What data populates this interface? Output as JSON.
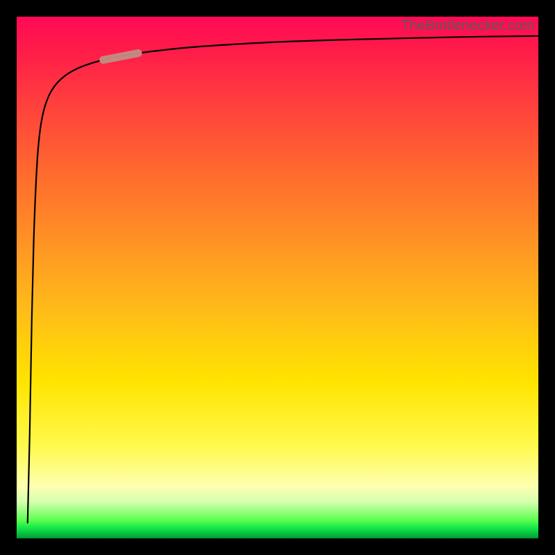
{
  "watermark": "TheBottlenecker.com",
  "colors": {
    "frame": "#000000",
    "curve": "#000000",
    "marker": "#c38d82",
    "gradient_stops": [
      "#ff0a56",
      "#ff3a3f",
      "#ff8f25",
      "#ffe400",
      "#feffb0",
      "#12e84a",
      "#009c35"
    ]
  },
  "chart_data": {
    "type": "line",
    "title": "",
    "xlabel": "",
    "ylabel": "",
    "xlim": [
      0,
      100
    ],
    "ylim": [
      0,
      100
    ],
    "note": "Axes carry no tick labels; values are read as percentages of the plot area. y is drawn inverted in pixel space (higher y value = nearer the top).",
    "series": [
      {
        "name": "bottleneck-curve",
        "x": [
          2.1,
          2.5,
          2.9,
          3.3,
          3.7,
          4.1,
          4.6,
          5.3,
          6.3,
          7.6,
          9.3,
          11.3,
          13.8,
          16.6,
          19.9,
          23.3,
          27.3,
          33.0,
          40.0,
          49.0,
          60.0,
          72.0,
          85.0,
          100.0
        ],
        "y": [
          3.0,
          20.0,
          42.0,
          58.0,
          68.0,
          74.5,
          79.0,
          82.4,
          85.1,
          87.1,
          88.7,
          89.9,
          90.9,
          91.7,
          92.4,
          93.0,
          93.5,
          94.1,
          94.6,
          95.1,
          95.5,
          95.8,
          96.1,
          96.3
        ]
      }
    ],
    "marker": {
      "x_range": [
        16.6,
        23.3
      ],
      "y_range": [
        91.7,
        93.0
      ],
      "meaning": "highlighted segment on the curve"
    }
  }
}
